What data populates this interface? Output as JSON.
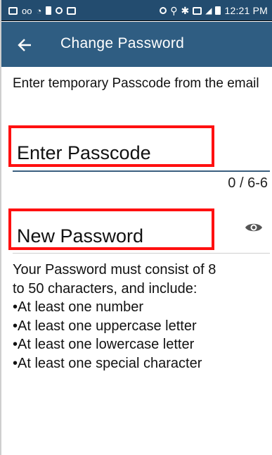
{
  "status_bar": {
    "time": "12:21 PM",
    "icons_left": [
      "gallery-icon",
      "voicemail-icon",
      "wifi-icon",
      "usb-icon",
      "shield-icon",
      "image-icon"
    ],
    "icons_right": [
      "sync-icon",
      "location-icon",
      "bluetooth-icon",
      "vibrate-icon",
      "wifi-icon",
      "signal-icon",
      "battery-icon"
    ]
  },
  "toolbar": {
    "title": "Change Password",
    "back_icon": "arrow-left-icon"
  },
  "form": {
    "instruction": "Enter temporary Passcode from the email",
    "passcode_value": "Enter Passcode",
    "passcode_counter": "0 / 6-6",
    "new_password_value": "New Password",
    "visibility_icon": "eye-icon"
  },
  "requirements": {
    "intro": "Your Password must consist of 8 to 50 characters, and include:",
    "items": [
      "•At least one number",
      "•At least one uppercase letter",
      "•At least one lowercase letter",
      "•At least one special character"
    ]
  },
  "colors": {
    "statusbar": "#234c6f",
    "toolbar": "#2f5d82",
    "annotation_box": "#ff1010",
    "field_underline": "#3b5f7f"
  }
}
